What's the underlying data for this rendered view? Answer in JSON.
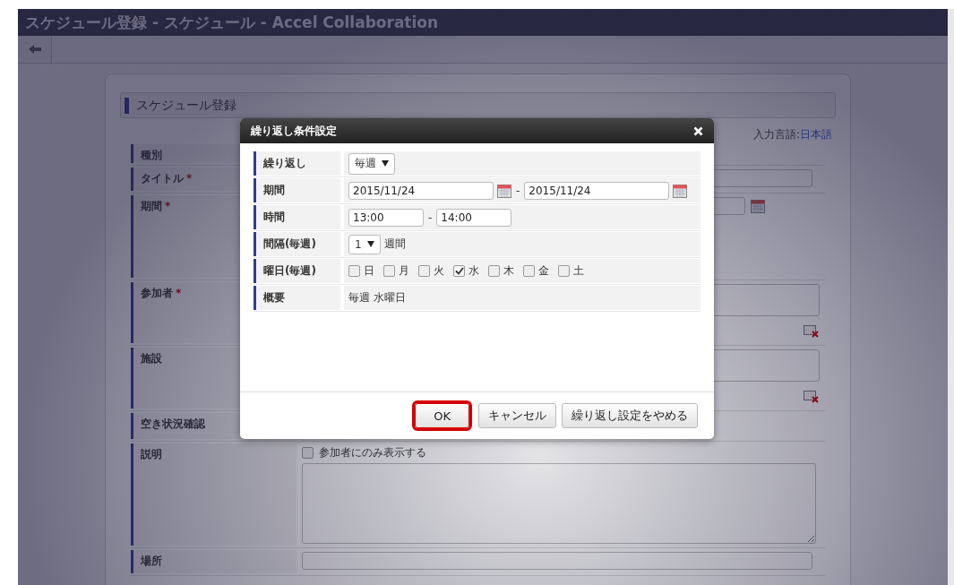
{
  "window": {
    "title": "スケジュール登録 - スケジュール - Accel Collaboration"
  },
  "form": {
    "heading": "スケジュール登録",
    "language_label": "入力言語:",
    "language_value": "日本語",
    "rows": [
      {
        "label": "種別",
        "kind": "blank"
      },
      {
        "label": "タイトル",
        "required_mark": "*",
        "kind": "text"
      },
      {
        "label": "期間",
        "required_mark": "*",
        "kind": "date"
      },
      {
        "label": "参加者",
        "required_mark": "*",
        "kind": "picker"
      },
      {
        "label": "施設",
        "kind": "picker"
      },
      {
        "label": "空き状況確認",
        "kind": "button"
      },
      {
        "label": "説明",
        "kind": "textarea",
        "checkbox": {
          "label": "参加者にのみ表示する",
          "checked": false
        }
      },
      {
        "label": "場所",
        "kind": "text"
      }
    ]
  },
  "dialog": {
    "title": "繰り返し条件設定",
    "rows": [
      {
        "label": "繰り返し",
        "kind": "select",
        "value": "毎週"
      },
      {
        "label": "期間",
        "kind": "date_range",
        "from": "2015/11/24",
        "separator": "-",
        "to": "2015/11/24"
      },
      {
        "label": "時間",
        "kind": "time_range",
        "from": "13:00",
        "separator": "-",
        "to": "14:00"
      },
      {
        "label": "間隔(毎週)",
        "kind": "interval",
        "value": "1",
        "unit": "週間"
      },
      {
        "label": "曜日(毎週)",
        "kind": "weekdays",
        "days": [
          {
            "label": "日",
            "checked": false
          },
          {
            "label": "月",
            "checked": false
          },
          {
            "label": "火",
            "checked": false
          },
          {
            "label": "水",
            "checked": true
          },
          {
            "label": "木",
            "checked": false
          },
          {
            "label": "金",
            "checked": false
          },
          {
            "label": "土",
            "checked": false
          }
        ]
      },
      {
        "label": "概要",
        "kind": "summary",
        "text": "毎週 水曜日"
      }
    ],
    "buttons": [
      {
        "label": "OK",
        "highlighted": true
      },
      {
        "label": "キャンセル",
        "highlighted": false
      },
      {
        "label": "繰り返し設定をやめる",
        "highlighted": false
      }
    ]
  }
}
